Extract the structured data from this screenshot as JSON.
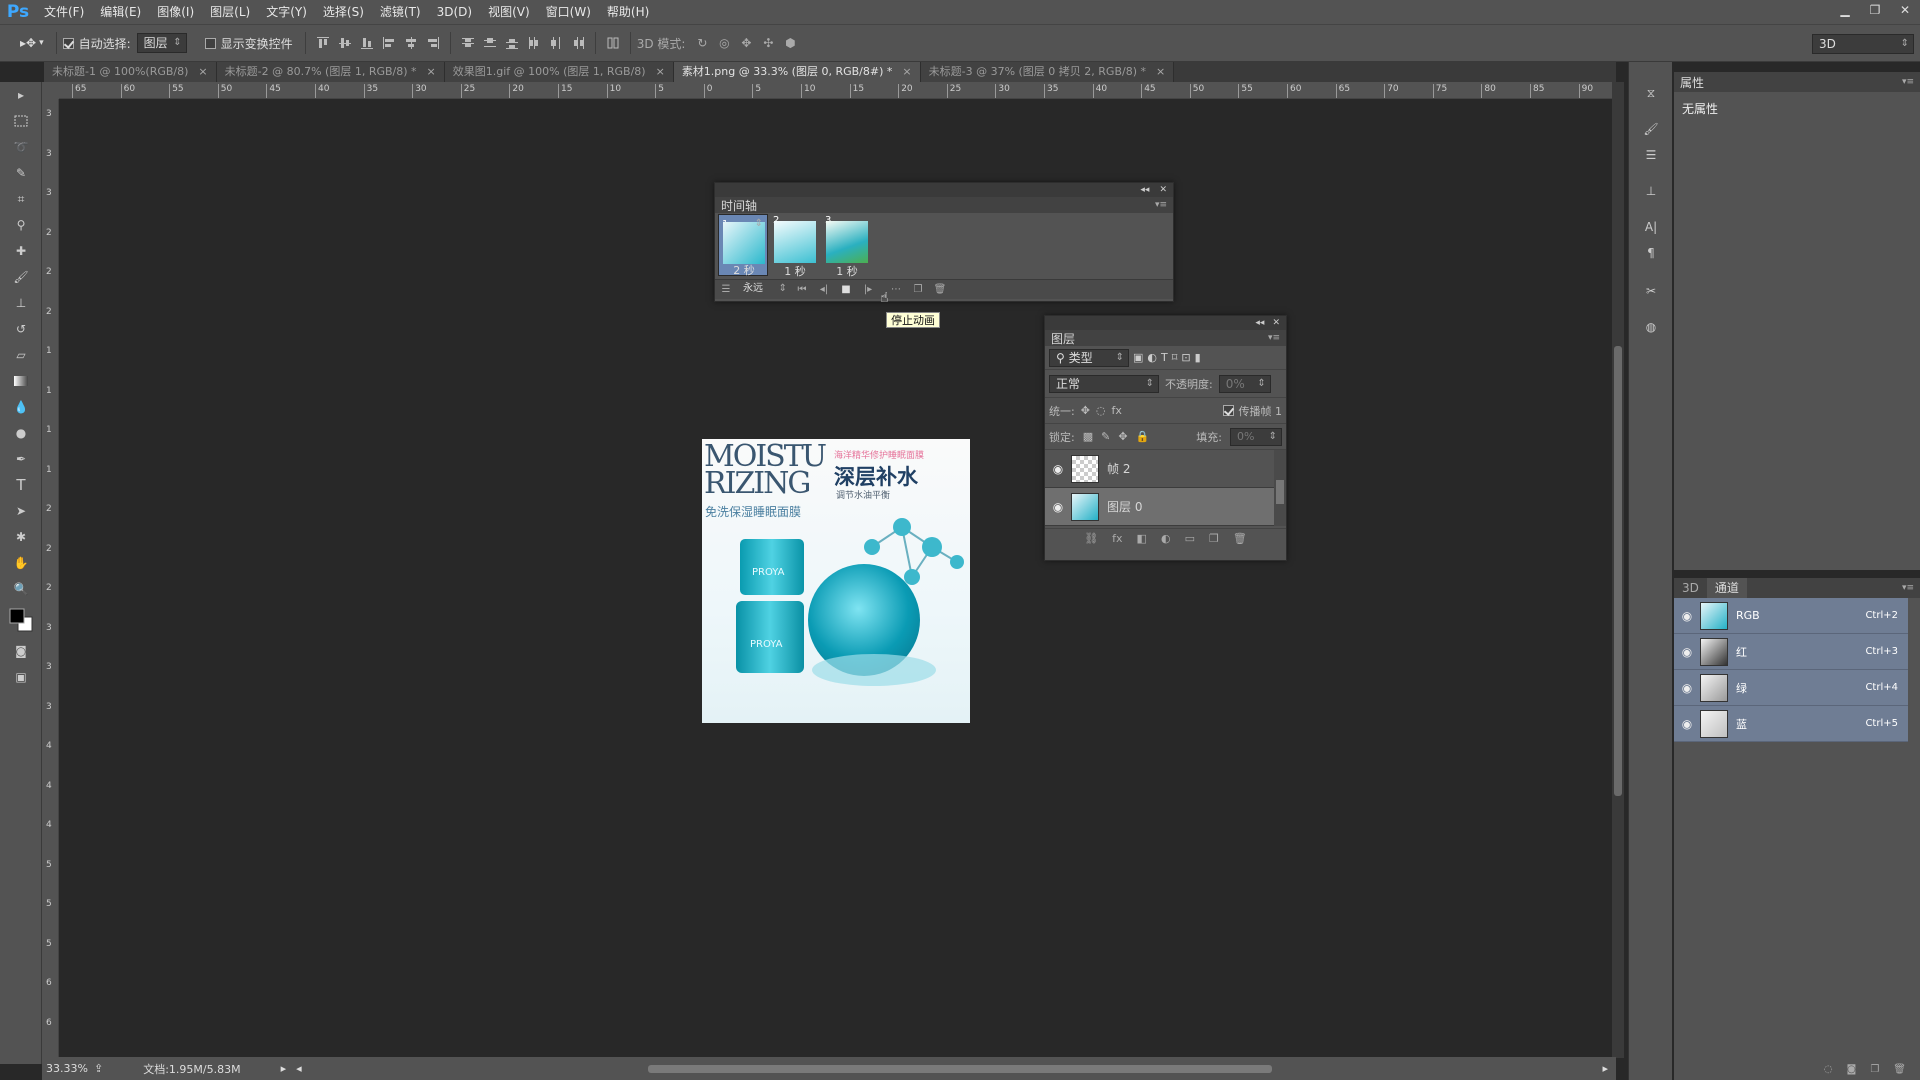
{
  "app": {
    "logo": "Ps"
  },
  "menu": [
    "文件(F)",
    "编辑(E)",
    "图像(I)",
    "图层(L)",
    "文字(Y)",
    "选择(S)",
    "滤镜(T)",
    "3D(D)",
    "视图(V)",
    "窗口(W)",
    "帮助(H)"
  ],
  "options": {
    "auto_select_label": "自动选择:",
    "auto_select_value": "图层",
    "show_transform_label": "显示变换控件",
    "mode_3d_label": "3D 模式:",
    "workspace": "3D"
  },
  "tabs": [
    {
      "label": "未标题-1 @ 100%(RGB/8)",
      "close": "×"
    },
    {
      "label": "未标题-2 @ 80.7% (图层 1, RGB/8) *",
      "close": "×"
    },
    {
      "label": "效果图1.gif @ 100% (图层 1, RGB/8)",
      "close": "×"
    },
    {
      "label": "素材1.png @ 33.3% (图层 0, RGB/8#) *",
      "close": "×"
    },
    {
      "label": "未标题-3 @ 37% (图层 0 拷贝 2, RGB/8) *",
      "close": "×"
    }
  ],
  "ruler_h": [
    "65",
    "60",
    "55",
    "50",
    "45",
    "40",
    "35",
    "30",
    "25",
    "20",
    "15",
    "10",
    "5",
    "0",
    "5",
    "10",
    "15",
    "20",
    "25",
    "30",
    "35",
    "40",
    "45",
    "50",
    "55",
    "60",
    "65",
    "70",
    "75",
    "80",
    "85",
    "90"
  ],
  "ruler_v": [
    "3",
    "3",
    "3",
    "2",
    "2",
    "2",
    "1",
    "1",
    "1",
    "1",
    "2",
    "2",
    "2",
    "3",
    "3",
    "3",
    "4",
    "4",
    "4",
    "5",
    "5",
    "5",
    "6",
    "6"
  ],
  "timeline": {
    "title": "时间轴",
    "frames": [
      {
        "n": "1",
        "dur": "2 秒"
      },
      {
        "n": "2",
        "dur": "1 秒"
      },
      {
        "n": "3",
        "dur": "1 秒"
      }
    ],
    "loop": "永远",
    "tooltip": "停止动画"
  },
  "layers": {
    "title": "图层",
    "filter": "类型",
    "blend": "正常",
    "opacity_label": "不透明度:",
    "opacity_value": "0%",
    "unify_label": "统一:",
    "propagate_label": "传播帧 1",
    "lock_label": "锁定:",
    "fill_label": "填充:",
    "fill_value": "0%",
    "rows": [
      {
        "name": "帧 2"
      },
      {
        "name": "图层 0"
      }
    ]
  },
  "poster": {
    "en_line1": "MOISTU",
    "en_line2": "RIZING",
    "cn_title": "深层补水",
    "cn_pink": "海洋精华修护睡眠面膜",
    "cn_sub": "调节水油平衡",
    "cn_side": "免洗保湿睡眠面膜",
    "brand": "PROYA"
  },
  "properties": {
    "title": "属性",
    "empty": "无属性"
  },
  "channels": {
    "tab_3d": "3D",
    "tab_channels": "通道",
    "rows": [
      {
        "name": "RGB",
        "key": "Ctrl+2"
      },
      {
        "name": "红",
        "key": "Ctrl+3"
      },
      {
        "name": "绿",
        "key": "Ctrl+4"
      },
      {
        "name": "蓝",
        "key": "Ctrl+5"
      }
    ]
  },
  "status": {
    "zoom": "33.33%",
    "doc": "文档:1.95M/5.83M"
  }
}
